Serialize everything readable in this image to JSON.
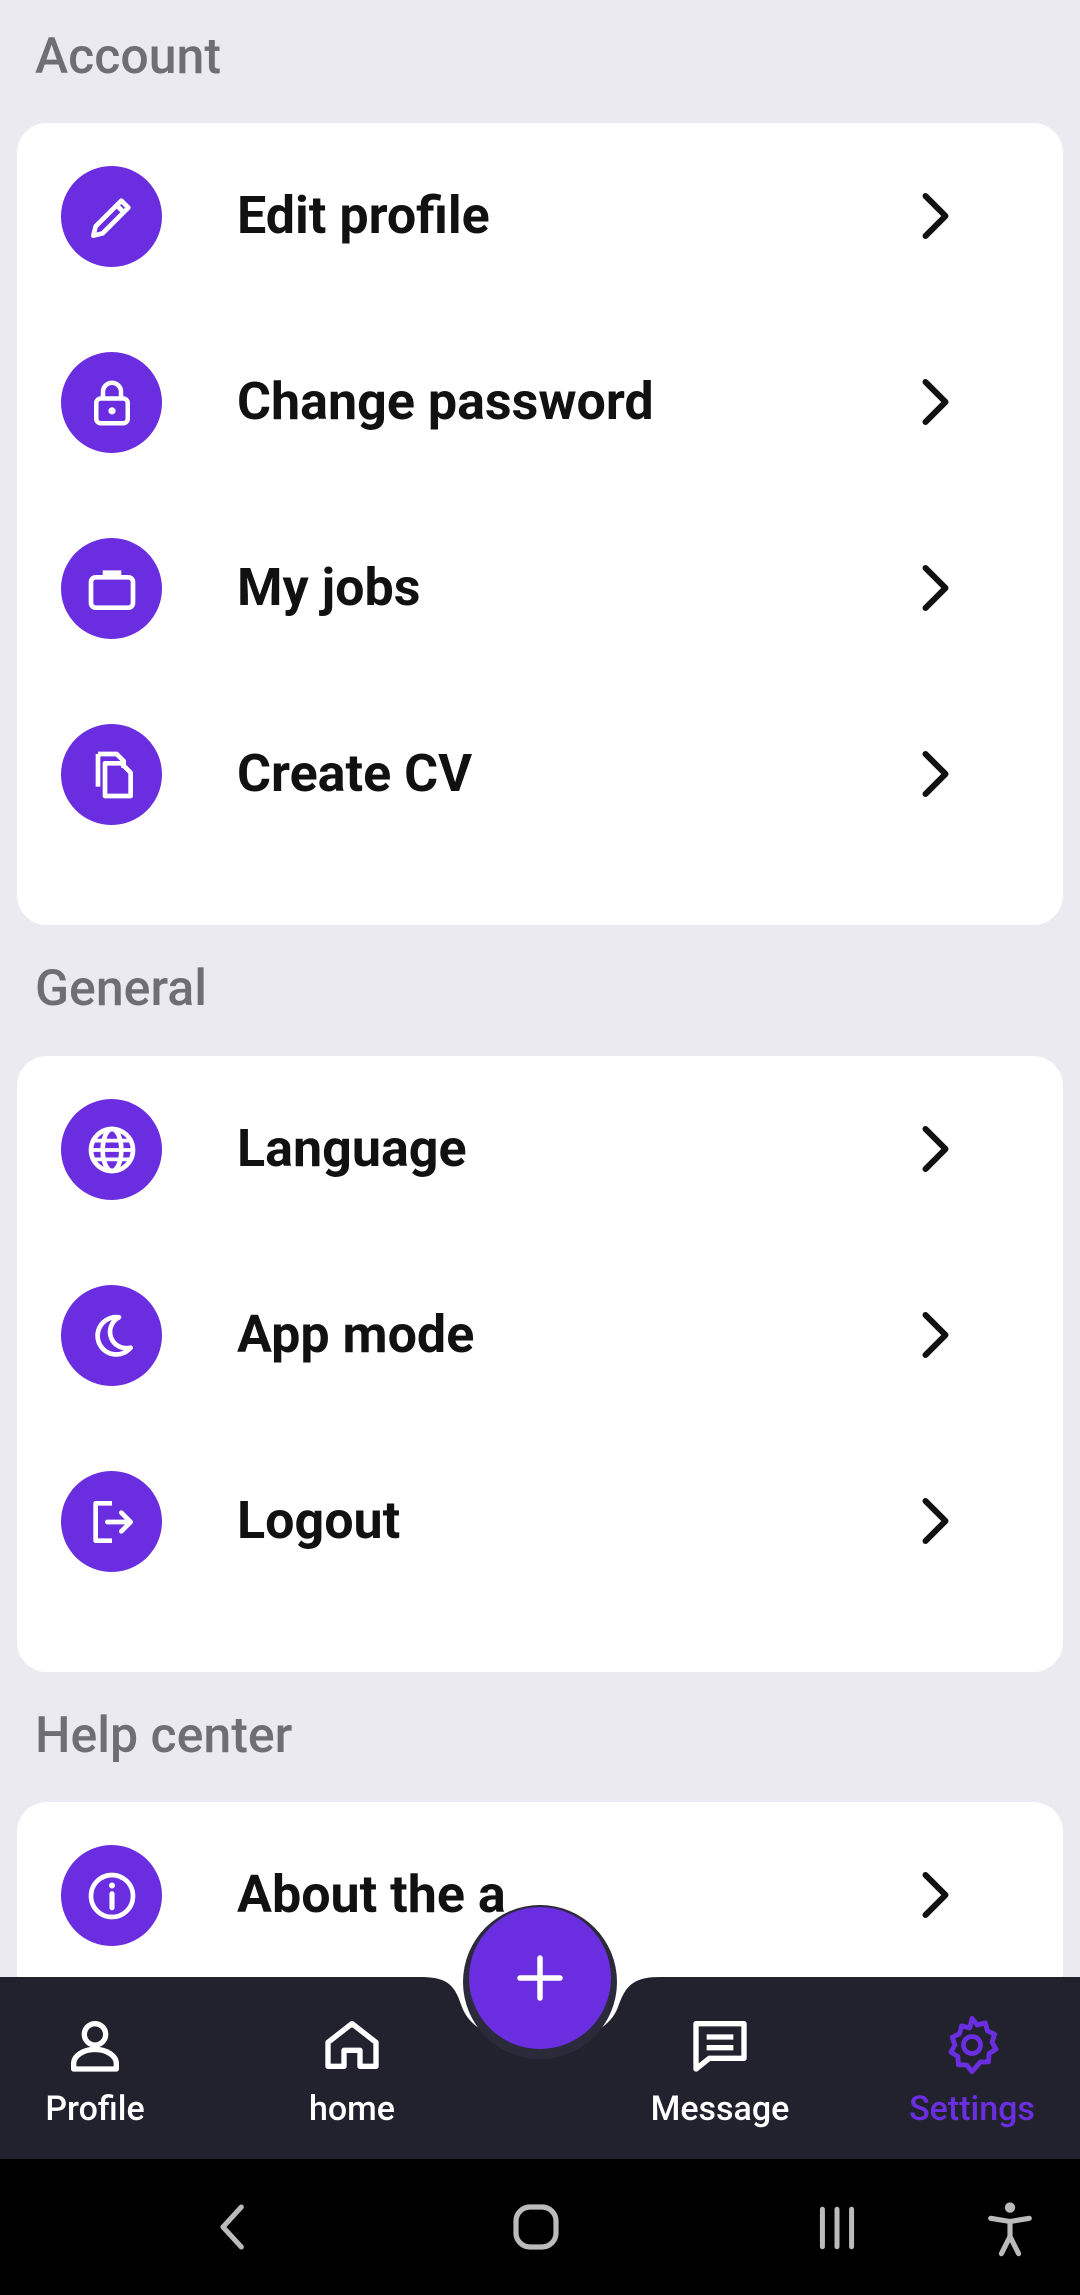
{
  "sections": {
    "account": {
      "title": "Account",
      "items": [
        {
          "label": "Edit profile",
          "icon": "pencil-icon"
        },
        {
          "label": "Change password",
          "icon": "lock-icon"
        },
        {
          "label": "My jobs",
          "icon": "briefcase-icon"
        },
        {
          "label": "Create CV",
          "icon": "copy-icon"
        }
      ]
    },
    "general": {
      "title": "General",
      "items": [
        {
          "label": "Language",
          "icon": "globe-icon"
        },
        {
          "label": "App mode",
          "icon": "moon-icon"
        },
        {
          "label": "Logout",
          "icon": "logout-icon"
        }
      ]
    },
    "help": {
      "title": "Help center",
      "items": [
        {
          "label": "About the a",
          "icon": "info-icon"
        }
      ]
    }
  },
  "bottom_nav": {
    "items": [
      {
        "label": "Profile",
        "icon": "person-icon"
      },
      {
        "label": "home",
        "icon": "home-icon"
      },
      {
        "label": "Message",
        "icon": "message-icon"
      },
      {
        "label": "Settings",
        "icon": "gear-icon",
        "active": true
      }
    ],
    "fab_icon": "plus-icon"
  },
  "colors": {
    "accent": "#6a2ee0",
    "nav_bg": "#22222f",
    "page_bg": "#ebeaf0",
    "active_nav": "#6a2ee0"
  }
}
